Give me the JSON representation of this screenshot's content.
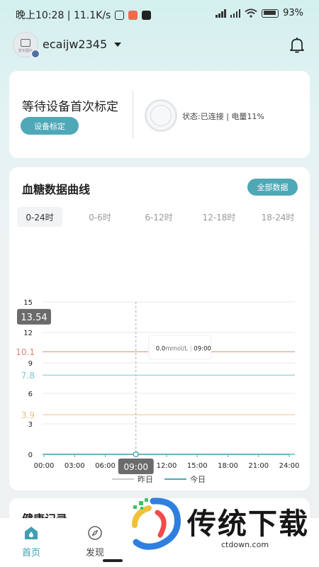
{
  "status_bar": {
    "time_speed": "晚上10:28 | 11.1K/s",
    "battery": "93"
  },
  "header": {
    "username": "ecaijw2345",
    "avatar_caption": "暂无图片"
  },
  "calibration": {
    "title": "等待设备首次标定",
    "button": "设备标定",
    "device_status": "状态:已连接 | 电量11%"
  },
  "chart_panel": {
    "title": "血糖数据曲线",
    "all_data_button": "全部数据",
    "tabs": [
      "0-24时",
      "0-6时",
      "6-12时",
      "12-18时",
      "18-24时"
    ],
    "active_tab": 0
  },
  "chart_data": {
    "type": "line",
    "x_ticks": [
      "00:00",
      "03:00",
      "06:00",
      "09:00",
      "12:00",
      "15:00",
      "18:00",
      "21:00",
      "24:00"
    ],
    "y_ticks": [
      0,
      3,
      6,
      9,
      12,
      15
    ],
    "xlim": [
      0,
      24
    ],
    "ylim": [
      0,
      15
    ],
    "reference_lines": [
      {
        "value": 13.54,
        "label": "13.54",
        "color": "#666666"
      },
      {
        "value": 10.1,
        "label": "10.1",
        "color": "#e0857a"
      },
      {
        "value": 7.8,
        "label": "7.8",
        "color": "#7dc9cf"
      },
      {
        "value": 3.9,
        "label": "3.9",
        "color": "#e9c383"
      }
    ],
    "series": [
      {
        "name": "昨日",
        "color": "#cccccc",
        "x": [
          0,
          24
        ],
        "y": [
          0,
          0
        ]
      },
      {
        "name": "今日",
        "color": "#4fa8b6",
        "x": [
          0,
          24
        ],
        "y": [
          0,
          0
        ]
      }
    ],
    "cursor": {
      "x": 9,
      "x_label": "09:00",
      "value": "0.0",
      "unit": "mmol/L",
      "time": "09:00"
    }
  },
  "health": {
    "title": "健康记录"
  },
  "bottom_nav": {
    "items": [
      {
        "label": "首页",
        "active": true
      },
      {
        "label": "发现",
        "active": false
      }
    ]
  },
  "watermark": {
    "text": "传统下载",
    "url": "ctdown.com"
  }
}
